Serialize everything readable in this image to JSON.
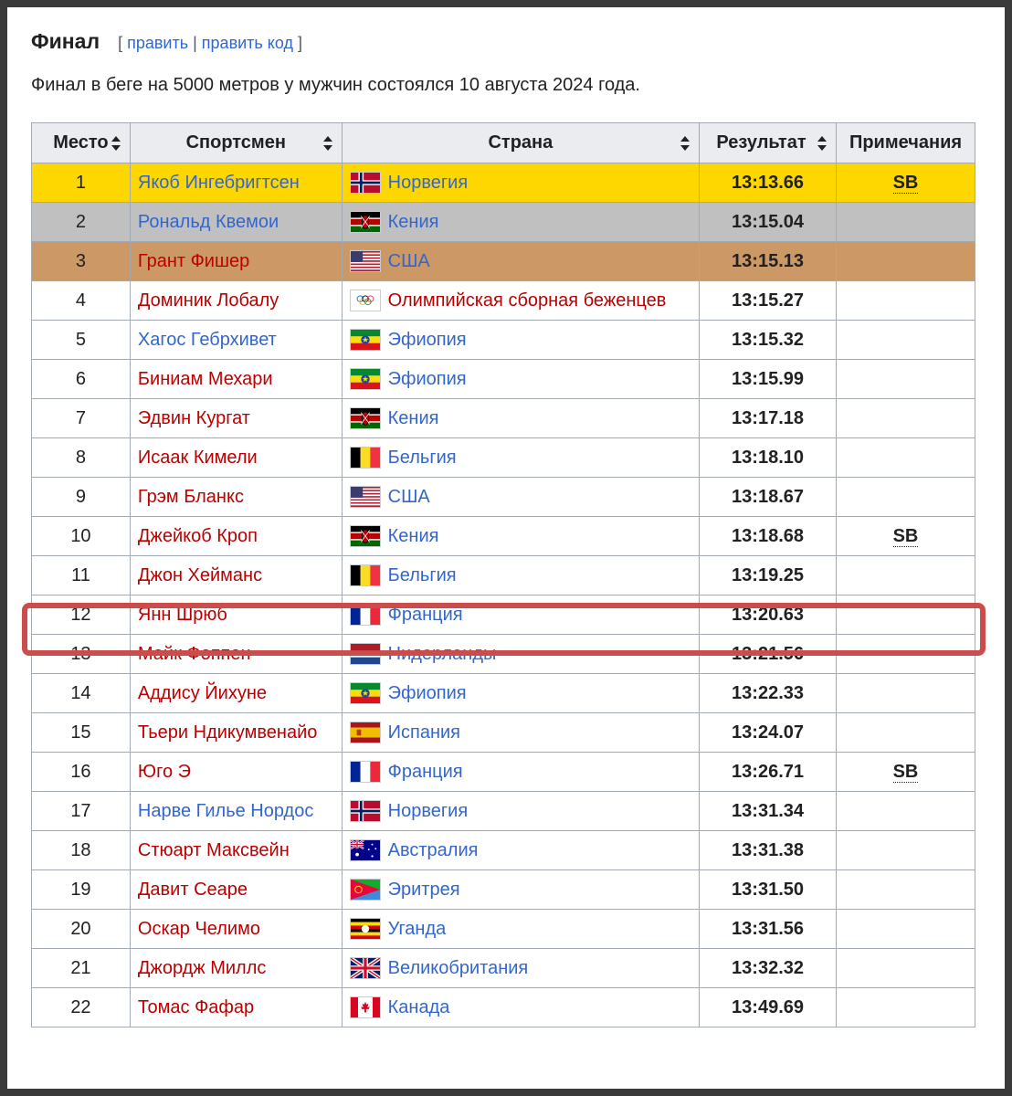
{
  "section": {
    "title": "Финал",
    "edit_open": "[ ",
    "edit_label": "править",
    "separator": " | ",
    "edit_code_label": "править код",
    "edit_close": " ]"
  },
  "intro_text": "Финал в беге на 5000 метров у мужчин состоялся 10 августа 2024 года.",
  "table": {
    "headers": {
      "place": "Место",
      "athlete": "Спортсмен",
      "country": "Страна",
      "result": "Результат",
      "notes": "Примечания"
    },
    "rows": [
      {
        "place": "1",
        "athlete": "Якоб Ингебригтсен",
        "athlete_link": "blue",
        "flag": "norway",
        "country": "Норвегия",
        "country_link": "blue",
        "result": "13:13.66",
        "notes": "SB",
        "medal": "gold"
      },
      {
        "place": "2",
        "athlete": "Рональд Квемои",
        "athlete_link": "blue",
        "flag": "kenya",
        "country": "Кения",
        "country_link": "blue",
        "result": "13:15.04",
        "notes": "",
        "medal": "silver"
      },
      {
        "place": "3",
        "athlete": "Грант Фишер",
        "athlete_link": "red",
        "flag": "usa",
        "country": "США",
        "country_link": "blue",
        "result": "13:15.13",
        "notes": "",
        "medal": "bronze"
      },
      {
        "place": "4",
        "athlete": "Доминик Лобалу",
        "athlete_link": "red",
        "flag": "olympic",
        "country": "Олимпийская сборная беженцев",
        "country_link": "red",
        "result": "13:15.27",
        "notes": "",
        "medal": ""
      },
      {
        "place": "5",
        "athlete": "Хагос Гебрхивет",
        "athlete_link": "blue",
        "flag": "ethiopia",
        "country": "Эфиопия",
        "country_link": "blue",
        "result": "13:15.32",
        "notes": "",
        "medal": ""
      },
      {
        "place": "6",
        "athlete": "Биниам Мехари",
        "athlete_link": "red",
        "flag": "ethiopia",
        "country": "Эфиопия",
        "country_link": "blue",
        "result": "13:15.99",
        "notes": "",
        "medal": ""
      },
      {
        "place": "7",
        "athlete": "Эдвин Кургат",
        "athlete_link": "red",
        "flag": "kenya",
        "country": "Кения",
        "country_link": "blue",
        "result": "13:17.18",
        "notes": "",
        "medal": ""
      },
      {
        "place": "8",
        "athlete": "Исаак Кимели",
        "athlete_link": "red",
        "flag": "belgium",
        "country": "Бельгия",
        "country_link": "blue",
        "result": "13:18.10",
        "notes": "",
        "medal": ""
      },
      {
        "place": "9",
        "athlete": "Грэм Бланкс",
        "athlete_link": "red",
        "flag": "usa",
        "country": "США",
        "country_link": "blue",
        "result": "13:18.67",
        "notes": "",
        "medal": ""
      },
      {
        "place": "10",
        "athlete": "Джейкоб Кроп",
        "athlete_link": "red",
        "flag": "kenya",
        "country": "Кения",
        "country_link": "blue",
        "result": "13:18.68",
        "notes": "SB",
        "medal": ""
      },
      {
        "place": "11",
        "athlete": "Джон Хейманс",
        "athlete_link": "red",
        "flag": "belgium",
        "country": "Бельгия",
        "country_link": "blue",
        "result": "13:19.25",
        "notes": "",
        "medal": ""
      },
      {
        "place": "12",
        "athlete": "Янн Шрюб",
        "athlete_link": "red",
        "flag": "france",
        "country": "Франция",
        "country_link": "blue",
        "result": "13:20.63",
        "notes": "",
        "medal": "",
        "highlighted": true
      },
      {
        "place": "13",
        "athlete": "Майк Фоппен",
        "athlete_link": "red",
        "flag": "netherlands",
        "country": "Нидерланды",
        "country_link": "blue",
        "result": "13:21.56",
        "notes": "",
        "medal": ""
      },
      {
        "place": "14",
        "athlete": "Аддису Йихуне",
        "athlete_link": "red",
        "flag": "ethiopia",
        "country": "Эфиопия",
        "country_link": "blue",
        "result": "13:22.33",
        "notes": "",
        "medal": ""
      },
      {
        "place": "15",
        "athlete": "Тьери Ндикумвенайо",
        "athlete_link": "red",
        "flag": "spain",
        "country": "Испания",
        "country_link": "blue",
        "result": "13:24.07",
        "notes": "",
        "medal": ""
      },
      {
        "place": "16",
        "athlete": "Юго Э",
        "athlete_link": "red",
        "flag": "france",
        "country": "Франция",
        "country_link": "blue",
        "result": "13:26.71",
        "notes": "SB",
        "medal": ""
      },
      {
        "place": "17",
        "athlete": "Нарве Гилье Нордос",
        "athlete_link": "blue",
        "flag": "norway",
        "country": "Норвегия",
        "country_link": "blue",
        "result": "13:31.34",
        "notes": "",
        "medal": ""
      },
      {
        "place": "18",
        "athlete": "Стюарт Максвейн",
        "athlete_link": "red",
        "flag": "australia",
        "country": "Австралия",
        "country_link": "blue",
        "result": "13:31.38",
        "notes": "",
        "medal": ""
      },
      {
        "place": "19",
        "athlete": "Давит Сеаре",
        "athlete_link": "red",
        "flag": "eritrea",
        "country": "Эритрея",
        "country_link": "blue",
        "result": "13:31.50",
        "notes": "",
        "medal": ""
      },
      {
        "place": "20",
        "athlete": "Оскар Челимо",
        "athlete_link": "red",
        "flag": "uganda",
        "country": "Уганда",
        "country_link": "blue",
        "result": "13:31.56",
        "notes": "",
        "medal": ""
      },
      {
        "place": "21",
        "athlete": "Джордж Миллс",
        "athlete_link": "red",
        "flag": "uk",
        "country": "Великобритания",
        "country_link": "blue",
        "result": "13:32.32",
        "notes": "",
        "medal": ""
      },
      {
        "place": "22",
        "athlete": "Томас Фафар",
        "athlete_link": "red",
        "flag": "canada",
        "country": "Канада",
        "country_link": "blue",
        "result": "13:49.69",
        "notes": "",
        "medal": ""
      }
    ]
  },
  "colors": {
    "link_blue": "#3366cc",
    "link_red": "#ba0000",
    "gold": "#ffd700",
    "silver": "#c0c0c0",
    "bronze": "#cc9966",
    "highlight_border": "#cc4b4b",
    "header_bg": "#eaecf0"
  }
}
